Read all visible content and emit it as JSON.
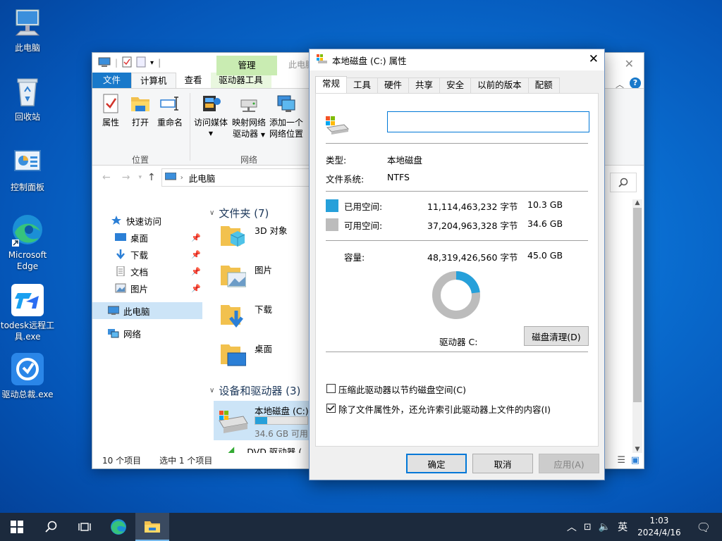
{
  "desktop": {
    "icons": [
      {
        "label": "此电脑"
      },
      {
        "label": "回收站"
      },
      {
        "label": "控制面板"
      },
      {
        "label": "Microsoft Edge"
      },
      {
        "label": "todesk远程工具.exe"
      },
      {
        "label": "驱动总裁.exe"
      }
    ]
  },
  "explorer": {
    "context_tab": "管理",
    "title": "此电脑",
    "tabs": [
      "文件",
      "计算机",
      "查看",
      "驱动器工具"
    ],
    "ribbon": {
      "props": "属性",
      "open": "打开",
      "rename": "重命名",
      "access_media": "访问媒体",
      "map_drive_1": "映射网络",
      "map_drive_2": "驱动器",
      "add_loc_1": "添加一个",
      "add_loc_2": "网络位置",
      "group_location": "位置",
      "group_network": "网络"
    },
    "address": "此电脑",
    "nav": {
      "quick_access": "快速访问",
      "desktop": "桌面",
      "downloads": "下载",
      "documents": "文档",
      "pictures": "图片",
      "this_pc": "此电脑",
      "network": "网络"
    },
    "folders_header": "文件夹 (7)",
    "folders": [
      "3D 对象",
      "图片",
      "下载",
      "桌面"
    ],
    "devices_header": "设备和驱动器 (3)",
    "drive_c": {
      "name": "本地磁盘 (C:)",
      "free": "34.6 GB 可用，",
      "used_fraction": 0.23
    },
    "dvd": "DVD 驱动器 (",
    "status_items": "10 个项目",
    "status_selected": "选中 1 个项目"
  },
  "dialog": {
    "title": "本地磁盘 (C:) 属性",
    "tabs": [
      "常规",
      "工具",
      "硬件",
      "共享",
      "安全",
      "以前的版本",
      "配额"
    ],
    "name_value": "",
    "type_label": "类型:",
    "type_value": "本地磁盘",
    "fs_label": "文件系统:",
    "fs_value": "NTFS",
    "used_label": "已用空间:",
    "used_bytes": "11,114,463,232 字节",
    "used_gb": "10.3 GB",
    "free_label": "可用空间:",
    "free_bytes": "37,204,963,328 字节",
    "free_gb": "34.6 GB",
    "cap_label": "容量:",
    "cap_bytes": "48,319,426,560 字节",
    "cap_gb": "45.0 GB",
    "drive_label": "驱动器 C:",
    "cleanup": "磁盘清理(D)",
    "compress": "压缩此驱动器以节约磁盘空间(C)",
    "index": "除了文件属性外，还允许索引此驱动器上文件的内容(I)",
    "ok": "确定",
    "cancel": "取消",
    "apply": "应用(A)",
    "used_fraction": 0.23,
    "used_color": "#26a0da",
    "free_color": "#bcbcbc"
  },
  "taskbar": {
    "ime": "英",
    "time": "1:03",
    "date": "2024/4/16"
  }
}
